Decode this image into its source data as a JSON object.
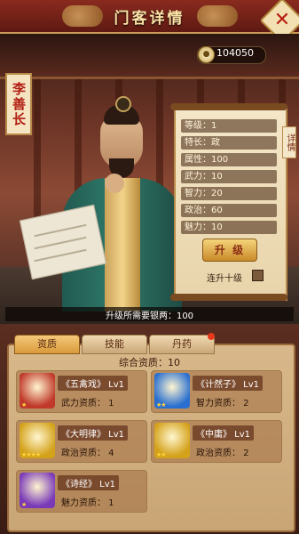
{
  "header": {
    "title": "门客详情",
    "close_icon": "close-x-icon"
  },
  "currency": {
    "silver": "104050",
    "icon": "silver-coin-icon"
  },
  "hero": {
    "name": "李善长"
  },
  "stats": [
    "等级：1",
    "特长：政",
    "属性：100",
    "武力：10",
    "智力：20",
    "政治：60",
    "魅力：10"
  ],
  "side_tab": {
    "label": "详情"
  },
  "upgrade": {
    "button_label": "升 级",
    "ten_label": "连升十级",
    "cost_text": "升级所需要银两：100"
  },
  "tabs": [
    "资质",
    "技能",
    "丹药"
  ],
  "aptitude": {
    "total_text": "综合资质：10"
  },
  "cards": [
    {
      "name": "《五禽戏》 Lv1",
      "stat": "武力资质：  1",
      "color": "#c0392b",
      "stars": "★"
    },
    {
      "name": "《计然子》 Lv1",
      "stat": "智力资质：  2",
      "color": "#2a6fd0",
      "stars": "★★"
    },
    {
      "name": "《大明律》 Lv1",
      "stat": "政治资质：  4",
      "color": "#d4a21a",
      "stars": "★★★★"
    },
    {
      "name": "《中庸》 Lv1",
      "stat": "政治资质：  2",
      "color": "#d4a21a",
      "stars": "★★"
    },
    {
      "name": "《诗经》 Lv1",
      "stat": "魅力资质：  1",
      "color": "#7a3ab8",
      "stars": "★"
    }
  ]
}
